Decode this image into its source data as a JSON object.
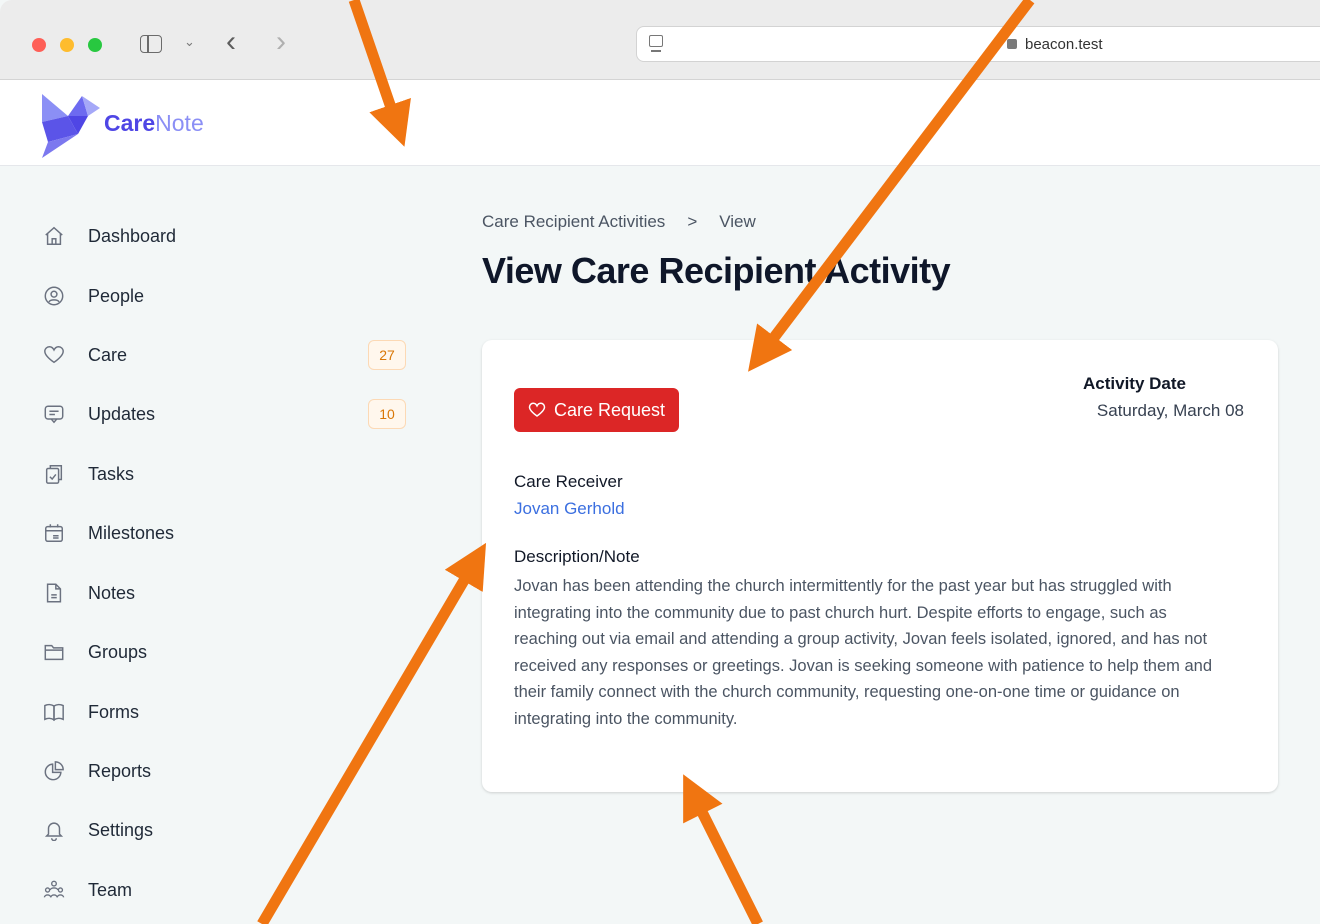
{
  "browser": {
    "url": "beacon.test"
  },
  "app": {
    "logo_primary": "Care",
    "logo_secondary": "Note"
  },
  "sidebar": {
    "items": [
      {
        "label": "Dashboard",
        "icon": "home-icon"
      },
      {
        "label": "People",
        "icon": "user-circle-icon"
      },
      {
        "label": "Care",
        "icon": "heart-icon",
        "badge": "27"
      },
      {
        "label": "Updates",
        "icon": "chat-icon",
        "badge": "10"
      },
      {
        "label": "Tasks",
        "icon": "clipboard-check-icon"
      },
      {
        "label": "Milestones",
        "icon": "calendar-icon"
      },
      {
        "label": "Notes",
        "icon": "document-icon"
      },
      {
        "label": "Groups",
        "icon": "folder-icon"
      },
      {
        "label": "Forms",
        "icon": "book-icon"
      },
      {
        "label": "Reports",
        "icon": "pie-chart-icon"
      },
      {
        "label": "Settings",
        "icon": "bell-icon"
      },
      {
        "label": "Team",
        "icon": "users-icon"
      }
    ]
  },
  "breadcrumb": {
    "parent": "Care Recipient Activities",
    "separator": ">",
    "current": "View"
  },
  "page": {
    "title": "View Care Recipient Activity"
  },
  "activity": {
    "type_label": "Care Request",
    "date_label": "Activity Date",
    "date_value": "Saturday, March 08",
    "receiver_label": "Care Receiver",
    "receiver_name": "Jovan Gerhold",
    "description_label": "Description/Note",
    "description": "Jovan has been attending the church intermittently for the past year but has struggled with integrating into the community due to past church hurt. Despite efforts to engage, such as reaching out via email and attending a group activity, Jovan feels isolated, ignored, and has not received any responses or greetings. Jovan is seeking someone with patience to help them and their family connect with the church community, requesting one-on-one time or guidance on integrating into the community."
  },
  "colors": {
    "accent": "#4f46e5",
    "danger": "#dc2626",
    "link": "#3b6fe0",
    "badge_bg": "#fff7ed",
    "badge_text": "#d97706",
    "annotation_arrow": "#f07511"
  }
}
